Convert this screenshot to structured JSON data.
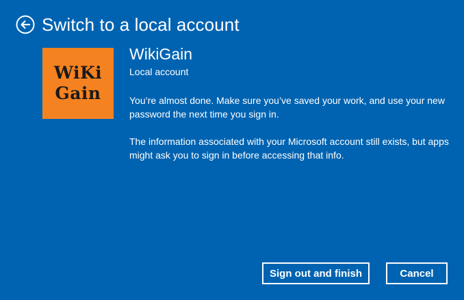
{
  "header": {
    "title": "Switch to a local account",
    "back_icon": "back-arrow-icon"
  },
  "avatar": {
    "line1": "WiKi",
    "line2": "Gain",
    "background": "#F58220"
  },
  "account": {
    "name": "WikiGain",
    "type": "Local account"
  },
  "messages": {
    "p1": "You’re almost done. Make sure you’ve saved your work, and use your new password the next time you sign in.",
    "p2": "The information associated with your Microsoft account still exists, but apps might ask you to sign in before accessing that info."
  },
  "buttons": {
    "finish": "Sign out and finish",
    "cancel": "Cancel"
  },
  "colors": {
    "background": "#0063B1",
    "text": "#FFFFFF"
  }
}
